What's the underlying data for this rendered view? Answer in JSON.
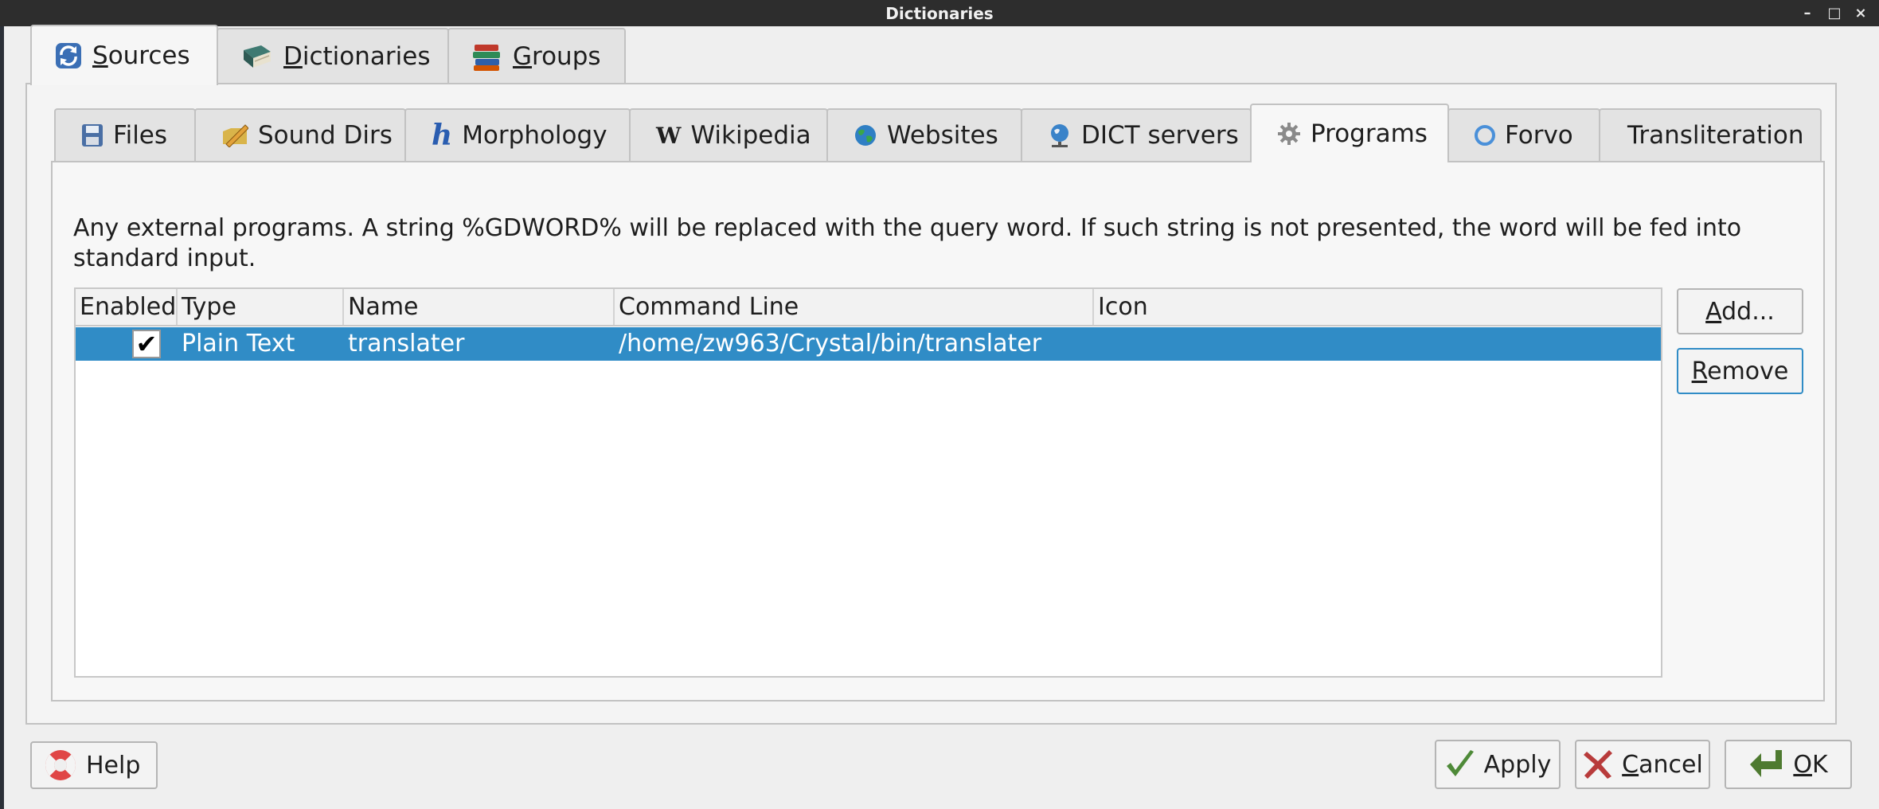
{
  "window": {
    "title": "Dictionaries",
    "controls": {
      "minimize": "–",
      "maximize": "□",
      "close": "×"
    }
  },
  "outer_tabs": [
    {
      "accel": "S",
      "rest": "ources",
      "icon": "sync-icon",
      "active": true
    },
    {
      "accel": "D",
      "rest": "ictionaries",
      "icon": "book-icon",
      "active": false
    },
    {
      "accel": "G",
      "rest": "roups",
      "icon": "books-stack-icon",
      "active": false
    }
  ],
  "inner_tabs": [
    {
      "label": "Files",
      "icon": "floppy-icon"
    },
    {
      "label": "Sound Dirs",
      "icon": "pencil-folder-icon"
    },
    {
      "label": "Morphology",
      "icon": "h-letter-icon",
      "glyph": "h"
    },
    {
      "label": "Wikipedia",
      "icon": "wikipedia-icon",
      "glyph": "W"
    },
    {
      "label": "Websites",
      "icon": "globe-icon"
    },
    {
      "label": "DICT servers",
      "icon": "network-globe-icon"
    },
    {
      "label": "Programs",
      "icon": "gear-icon",
      "active": true
    },
    {
      "label": "Forvo",
      "icon": "forvo-icon"
    },
    {
      "label": "Transliteration",
      "icon": ""
    }
  ],
  "programs": {
    "description": "Any external programs. A string %GDWORD% will be replaced with the query word. If such string is not presented, the word will be fed into standard input.",
    "columns": [
      "Enabled",
      "Type",
      "Name",
      "Command Line",
      "Icon"
    ],
    "rows": [
      {
        "enabled": true,
        "checkmark": "✔",
        "type": "Plain Text",
        "name": "translater",
        "command": "/home/zw963/Crystal/bin/translater",
        "icon": ""
      }
    ],
    "add": {
      "accel": "A",
      "rest": "dd..."
    },
    "remove": {
      "accel": "R",
      "rest": "emove"
    }
  },
  "footer": {
    "help": {
      "label": "Help",
      "icon": "lifebuoy-icon"
    },
    "apply": {
      "label": "Apply",
      "icon": "checkmark-icon"
    },
    "cancel": {
      "accel": "C",
      "rest": "ancel",
      "icon": "cross-icon"
    },
    "ok": {
      "accel": "O",
      "rest": "K",
      "icon": "enter-arrow-icon"
    }
  },
  "colors": {
    "selection": "#308cc6",
    "titlebar": "#2d2d2d"
  }
}
